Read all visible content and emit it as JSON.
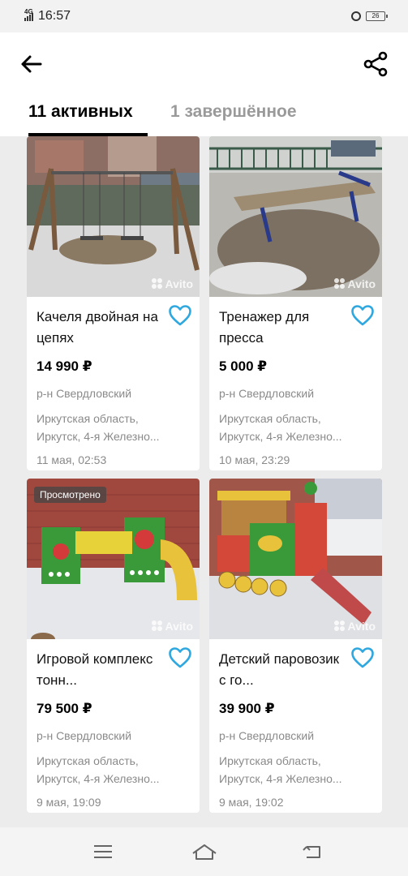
{
  "status_bar": {
    "network": "4G",
    "time": "16:57",
    "battery": "26"
  },
  "header": {
    "back_icon": "arrow-left-icon",
    "share_icon": "share-icon"
  },
  "tabs": [
    {
      "label": "11 активных",
      "active": true
    },
    {
      "label": "1 завершённое",
      "active": false
    }
  ],
  "watermark": "Avito",
  "cards": [
    {
      "title": "Качеля двойная на цепях",
      "price": "14 990 ₽",
      "district": "р-н Свердловский",
      "address_line1": "Иркутская область,",
      "address_line2": "Иркутск, 4-я Железно...",
      "date": "11 мая, 02:53",
      "badge": ""
    },
    {
      "title": "Тренажер для пресса",
      "price": "5 000 ₽",
      "district": "р-н Свердловский",
      "address_line1": "Иркутская область,",
      "address_line2": "Иркутск, 4-я Железно...",
      "date": "10 мая, 23:29",
      "badge": ""
    },
    {
      "title": "Игровой комплекс тонн...",
      "price": "79 500 ₽",
      "district": "р-н Свердловский",
      "address_line1": "Иркутская область,",
      "address_line2": "Иркутск, 4-я Железно...",
      "date": "9 мая, 19:09",
      "badge": "Просмотрено"
    },
    {
      "title": "Детский паровозик с го...",
      "price": "39 900 ₽",
      "district": "р-н Свердловский",
      "address_line1": "Иркутская область,",
      "address_line2": "Иркутск, 4-я Железно...",
      "date": "9 мая, 19:02",
      "badge": ""
    }
  ],
  "colors": {
    "accent": "#2fa8e0",
    "inactive_tab": "#9a9a9a",
    "secondary_text": "#8a8a8a"
  }
}
